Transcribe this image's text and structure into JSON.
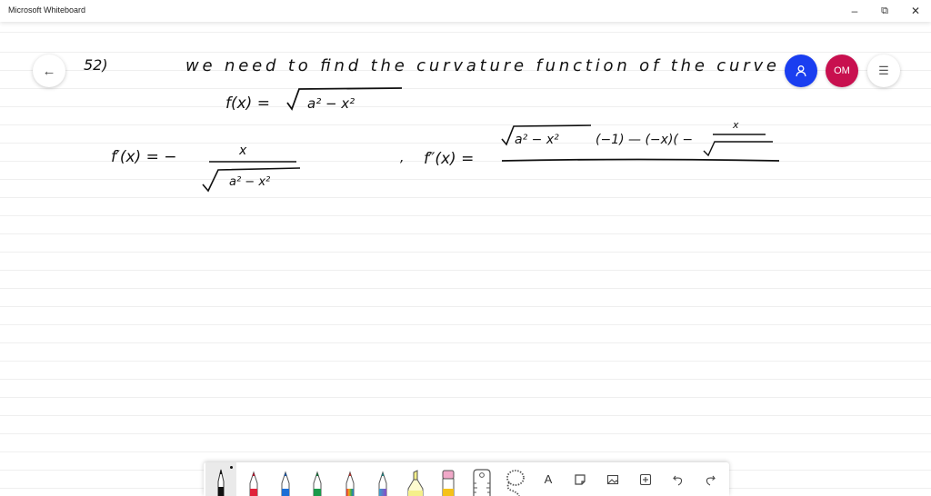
{
  "window": {
    "title": "Microsoft Whiteboard",
    "controls": {
      "minimize": "–",
      "restore": "⧉",
      "close": "✕"
    }
  },
  "header": {
    "back_icon": "←",
    "invite_icon": "person-icon",
    "user_initials": "OM",
    "menu_icon": "☰",
    "colors": {
      "invite": "#1a3ef0",
      "user": "#c8104f"
    }
  },
  "board": {
    "problem_number": "52)",
    "sentence": "we need to find the curvature function of the curve",
    "f_lhs": "f(x) =",
    "f_radicand": "a² − x²",
    "fprime_lhs": "f′(x) = −",
    "fprime_num": "x",
    "fprime_den": "a² − x²",
    "separator": ",",
    "fdouble_lhs": "f″(x) =",
    "fdouble_num_radicand": "a² − x²",
    "fdouble_num_rest": "(−1) — (−x)( −",
    "fdouble_inner_num": "x"
  },
  "toolbar": {
    "tools": [
      {
        "name": "black-pen",
        "color": "#111111"
      },
      {
        "name": "red-pen",
        "color": "#e0223a"
      },
      {
        "name": "blue-pen",
        "color": "#1d6fd6"
      },
      {
        "name": "green-pen",
        "color": "#1a9a4a"
      },
      {
        "name": "rainbow-pen",
        "color": "#e86a1a"
      },
      {
        "name": "galaxy-pen",
        "color": "#4a8fbf"
      },
      {
        "name": "highlighter",
        "color": "#f5f08a"
      },
      {
        "name": "eraser",
        "color": "#f0a8c8"
      },
      {
        "name": "ruler",
        "color": "#ffffff"
      },
      {
        "name": "lasso",
        "color": "#ffffff"
      }
    ],
    "text_tool_label": "A",
    "selected_tool": "black-pen"
  }
}
